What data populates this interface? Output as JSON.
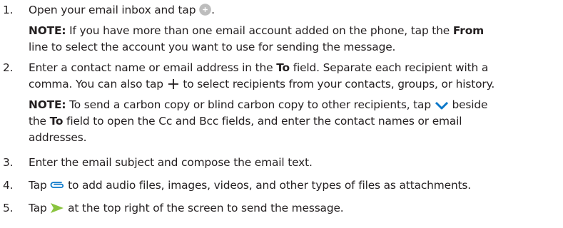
{
  "steps": [
    {
      "number": "1.",
      "text": "Open your email inbox and tap",
      "text_end": ".",
      "icon": "compose-plus-circle-icon",
      "note": {
        "label": "NOTE:",
        "line1_a": "If you have more than one email account added on the phone, tap the",
        "line1_bold": "From",
        "line2": "line to select the account you want to use for sending the message."
      }
    },
    {
      "number": "2.",
      "line1_a": "Enter a contact name or email address in the",
      "line1_bold": "To",
      "line1_b": "field. Separate each recipient with a",
      "line2_a": "comma. You can also tap",
      "line2_b": "to select recipients from your contacts, groups, or history.",
      "icon": "plus-icon",
      "note": {
        "label": "NOTE:",
        "line1_a": "To send a carbon copy or blind carbon copy to other recipients, tap",
        "line1_b": "beside",
        "line2_a": "the",
        "line2_bold": "To",
        "line2_b": "field to open the Cc and Bcc fields, and enter the contact names or email",
        "line3": "addresses.",
        "icon": "chevron-down-icon"
      }
    },
    {
      "number": "3.",
      "text": "Enter the email subject and compose the email text."
    },
    {
      "number": "4.",
      "text_a": "Tap",
      "text_b": "to add audio files, images, videos, and other types of files as attachments.",
      "icon": "paperclip-attach-icon"
    },
    {
      "number": "5.",
      "text_a": "Tap",
      "text_b": "at the top right of the screen to send the message.",
      "icon": "send-icon"
    }
  ],
  "colors": {
    "text": "#231f20",
    "icon_gray": "#9e9e9e",
    "send_green": "#8ac43f"
  }
}
